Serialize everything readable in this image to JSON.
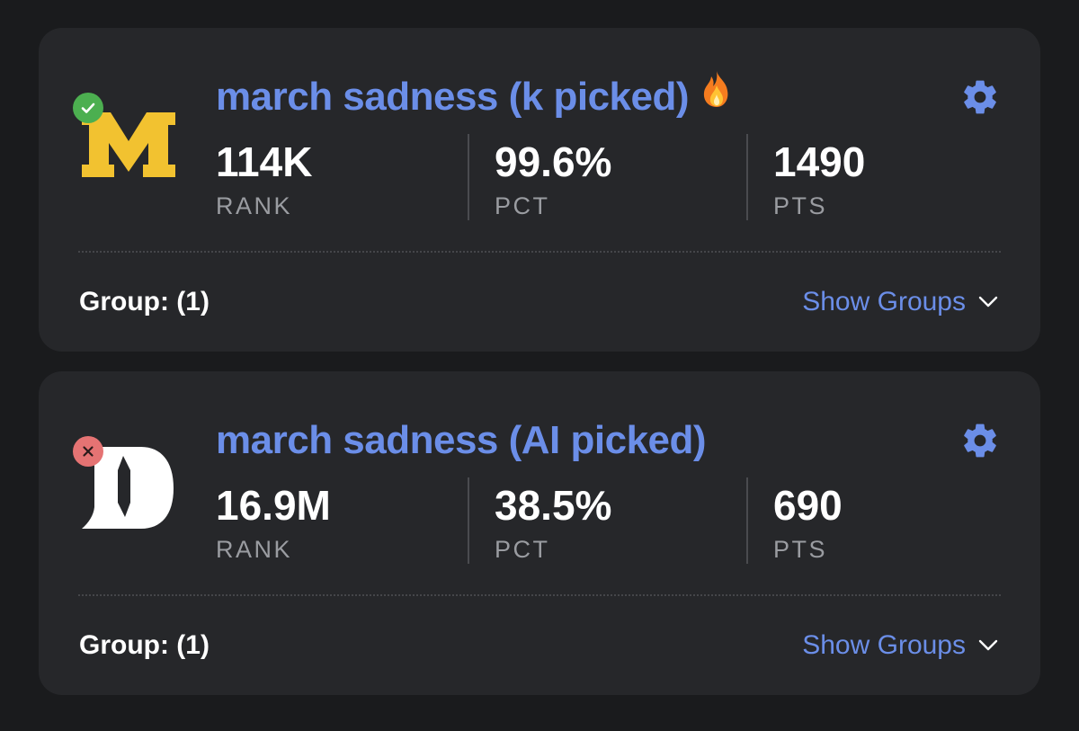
{
  "brackets": [
    {
      "title": "march sadness (k picked)",
      "status": "correct",
      "has_flame": true,
      "logo": "michigan-m-logo",
      "logo_color": "#f2c230",
      "rank": {
        "value": "114K",
        "label": "RANK"
      },
      "pct": {
        "value": "99.6%",
        "label": "PCT"
      },
      "pts": {
        "value": "1490",
        "label": "PTS"
      },
      "group_label": "Group: (1)",
      "show_groups_label": "Show Groups"
    },
    {
      "title": "march sadness (AI picked)",
      "status": "incorrect",
      "has_flame": false,
      "logo": "duke-d-logo",
      "logo_color": "#ffffff",
      "rank": {
        "value": "16.9M",
        "label": "RANK"
      },
      "pct": {
        "value": "38.5%",
        "label": "PCT"
      },
      "pts": {
        "value": "690",
        "label": "PTS"
      },
      "group_label": "Group: (1)",
      "show_groups_label": "Show Groups"
    }
  ],
  "colors": {
    "background": "#1a1b1d",
    "card": "#26272a",
    "accent": "#6b8ee8",
    "correct_badge": "#4caf50",
    "incorrect_badge": "#e57373",
    "michigan_maize": "#f2c230"
  },
  "icons": {
    "settings": "gear-icon",
    "expand": "chevron-down-icon",
    "correct": "check-icon",
    "incorrect": "close-icon",
    "flame": "fire-icon"
  }
}
